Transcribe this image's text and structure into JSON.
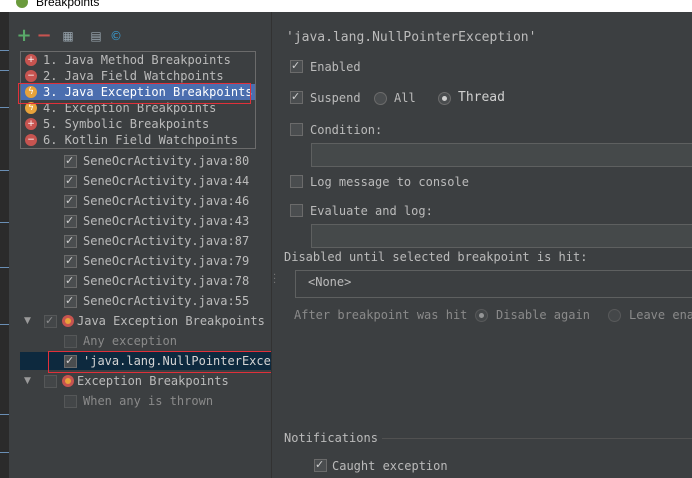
{
  "window": {
    "title": "Breakpoints"
  },
  "popup": {
    "items": [
      {
        "label": "1. Java Method Breakpoints"
      },
      {
        "label": "2. Java Field Watchpoints"
      },
      {
        "label": "3. Java Exception Breakpoints"
      },
      {
        "label": "4. Exception Breakpoints"
      },
      {
        "label": "5. Symbolic Breakpoints"
      },
      {
        "label": "6. Kotlin Field Watchpoints"
      }
    ]
  },
  "tree": {
    "line_items": [
      "SeneOcrActivity.java:80",
      "SeneOcrActivity.java:44",
      "SeneOcrActivity.java:46",
      "SeneOcrActivity.java:43",
      "SeneOcrActivity.java:87",
      "SeneOcrActivity.java:79",
      "SeneOcrActivity.java:78",
      "SeneOcrActivity.java:55"
    ],
    "java_exception_group": "Java Exception Breakpoints",
    "any_exception": "Any exception",
    "npe_item": "'java.lang.NullPointerExcep",
    "exception_group": "Exception Breakpoints",
    "when_any_thrown": "When any is thrown"
  },
  "details": {
    "title": "'java.lang.NullPointerException'",
    "enabled_label": "Enabled",
    "suspend_label": "Suspend",
    "all_label": "All",
    "thread_label": "Thread",
    "condition_label": "Condition:",
    "log_message_label": "Log message to console",
    "evaluate_log_label": "Evaluate and log:",
    "disabled_until_label": "Disabled until selected breakpoint is hit:",
    "none_option": "<None>",
    "after_hit_label": "After breakpoint was hit",
    "disable_again_label": "Disable again",
    "leave_enabled_label": "Leave ena",
    "notifications_label": "Notifications",
    "caught_exception_label": "Caught exception"
  }
}
